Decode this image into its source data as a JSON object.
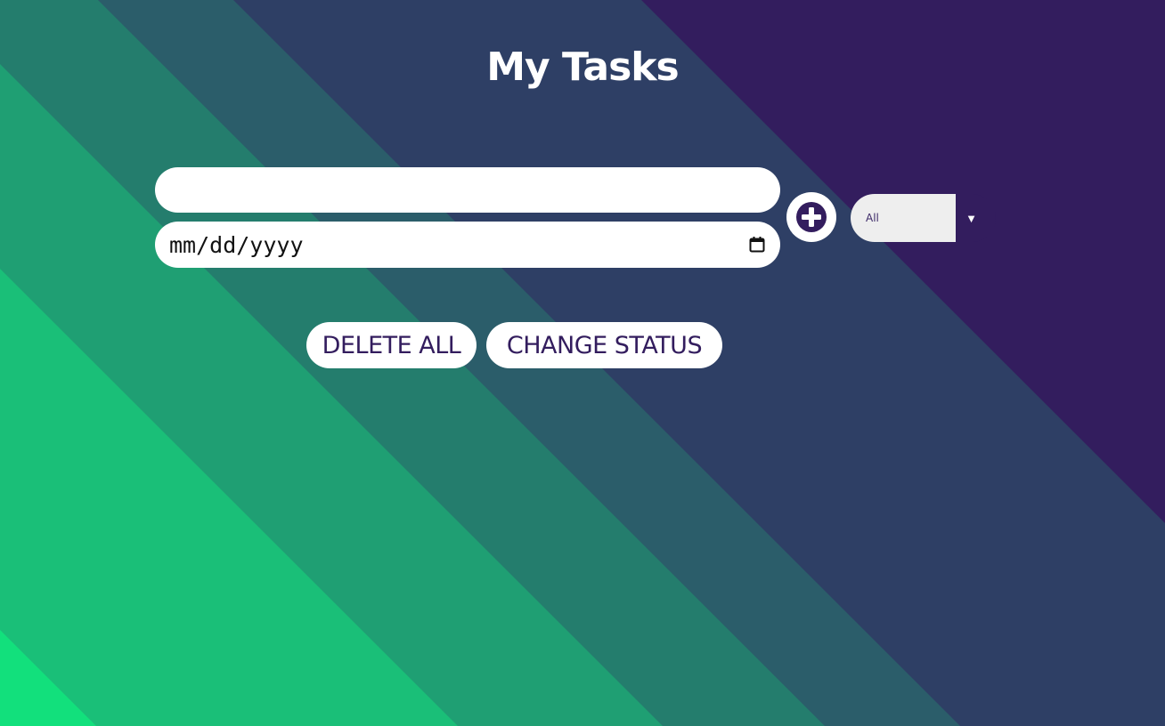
{
  "page": {
    "title": "My Tasks"
  },
  "task_form": {
    "task_input": {
      "value": "",
      "placeholder": ""
    },
    "date_input": {
      "display": "mm/dd/yyyy"
    },
    "add_button_icon": "plus-circle-icon",
    "calendar_icon": "calendar-icon"
  },
  "filter": {
    "selected": "All",
    "arrow": "▼"
  },
  "actions": {
    "delete_all_label": "DELETE ALL",
    "change_status_label": "CHANGE STATUS"
  },
  "colors": {
    "accent": "#331d5e",
    "button_bg": "#ffffff",
    "background_stripes": [
      "#12e07c",
      "#1abf78",
      "#1f9f73",
      "#247d6d",
      "#2b5d6a",
      "#2e3f65",
      "#331d5e"
    ]
  }
}
